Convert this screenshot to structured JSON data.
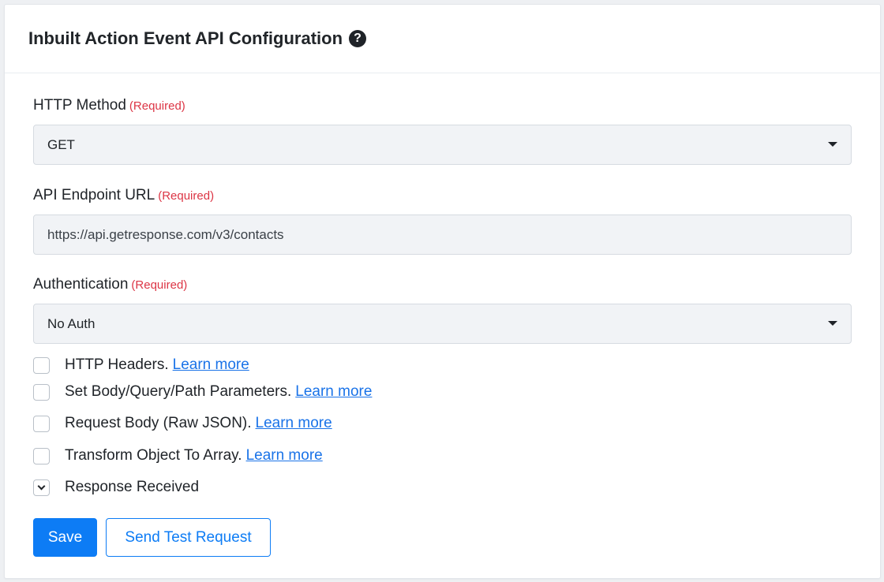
{
  "card": {
    "title": "Inbuilt Action Event API Configuration",
    "help_glyph": "?"
  },
  "http_method": {
    "label": "HTTP Method",
    "required": "(Required)",
    "value": "GET"
  },
  "endpoint": {
    "label": "API Endpoint URL",
    "required": "(Required)",
    "value": "https://api.getresponse.com/v3/contacts"
  },
  "authentication": {
    "label": "Authentication",
    "required": "(Required)",
    "value": "No Auth"
  },
  "options": [
    {
      "label": "HTTP Headers.",
      "link": "Learn more",
      "checked": false
    },
    {
      "label": "Set Body/Query/Path Parameters.",
      "link": "Learn more",
      "checked": false
    },
    {
      "label": "Request Body (Raw JSON).",
      "link": "Learn more",
      "checked": false
    },
    {
      "label": "Transform Object To Array.",
      "link": "Learn more",
      "checked": false
    },
    {
      "label": "Response Received",
      "checked": true
    }
  ],
  "buttons": {
    "save": "Save",
    "send_test": "Send Test Request"
  },
  "colors": {
    "primary": "#0d7cf5",
    "required": "#dc3545",
    "link": "#1a73e8"
  },
  "icons": {
    "help": "question-circle-icon",
    "dropdown": "caret-down-icon",
    "check": "checkmark-icon"
  }
}
